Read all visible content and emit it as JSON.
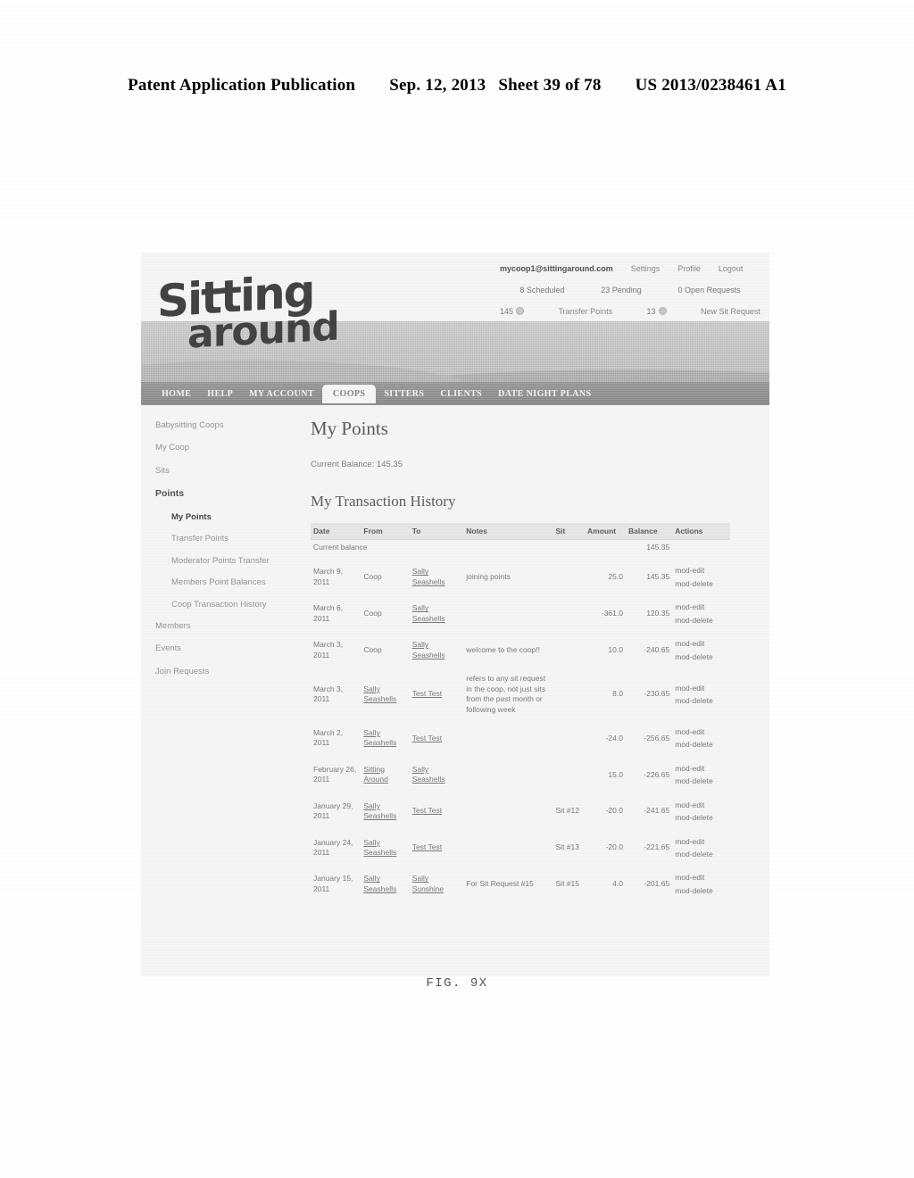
{
  "patent_header": {
    "publication": "Patent Application Publication",
    "date": "Sep. 12, 2013",
    "sheet": "Sheet 39 of 78",
    "number": "US 2013/0238461 A1"
  },
  "figure_caption": "FIG. 9X",
  "site": {
    "logo_line1": "Sitting",
    "logo_line2": "around",
    "account": {
      "email": "mycoop1@sittingaround.com",
      "settings_label": "Settings",
      "profile_label": "Profile",
      "logout_label": "Logout",
      "scheduled": "8 Scheduled",
      "pending": "23 Pending",
      "open_requests": "0 Open Requests",
      "points_balance": "145",
      "transfer_points_label": "Transfer Points",
      "sit_count": "13",
      "new_sit_request_label": "New Sit Request"
    },
    "nav": [
      {
        "label": "HOME",
        "active": false
      },
      {
        "label": "HELP",
        "active": false
      },
      {
        "label": "MY ACCOUNT",
        "active": false
      },
      {
        "label": "COOPS",
        "active": true
      },
      {
        "label": "SITTERS",
        "active": false
      },
      {
        "label": "CLIENTS",
        "active": false
      },
      {
        "label": "DATE NIGHT PLANS",
        "active": false
      }
    ],
    "sidebar": {
      "items": [
        {
          "label": "Babysitting Coops",
          "level": "top"
        },
        {
          "label": "My Coop",
          "level": "top"
        },
        {
          "label": "Sits",
          "level": "top"
        },
        {
          "label": "Points",
          "level": "head"
        },
        {
          "label": "My Points",
          "level": "sub-current"
        },
        {
          "label": "Transfer Points",
          "level": "sub"
        },
        {
          "label": "Moderator Points Transfer",
          "level": "sub"
        },
        {
          "label": "Members Point Balances",
          "level": "sub"
        },
        {
          "label": "Coop Transaction History",
          "level": "sub"
        },
        {
          "label": "Members",
          "level": "top"
        },
        {
          "label": "Events",
          "level": "top"
        },
        {
          "label": "Join Requests",
          "level": "top"
        }
      ]
    },
    "main": {
      "page_title": "My Points",
      "current_balance_line": "Current Balance: 145.35",
      "section_title": "My Transaction History",
      "table": {
        "columns": [
          "Date",
          "From",
          "To",
          "Notes",
          "Sit",
          "Amount",
          "Balance",
          "Actions"
        ],
        "current_balance_row": {
          "label": "Current balance",
          "balance": "145.35"
        },
        "action_edit": "mod-edit",
        "action_delete": "mod-delete",
        "rows": [
          {
            "date": "March 9, 2011",
            "from": "Coop",
            "to": "Sally Seashells",
            "notes": "joining points",
            "sit": "",
            "amount": "25.0",
            "balance": "145.35"
          },
          {
            "date": "March 6, 2011",
            "from": "Coop",
            "to": "Sally Seashells",
            "notes": "",
            "sit": "",
            "amount": "-361.0",
            "balance": "120.35"
          },
          {
            "date": "March 3, 2011",
            "from": "Coop",
            "to": "Sally Seashells",
            "notes": "welcome to the coop!!",
            "sit": "",
            "amount": "10.0",
            "balance": "-240.65"
          },
          {
            "date": "March 3, 2011",
            "from": "Sally Seashells",
            "to": "Test Test",
            "notes": "refers to any sit request in the coop, not just sits from the past month or following week",
            "sit": "",
            "amount": "8.0",
            "balance": "-230.65"
          },
          {
            "date": "March 2, 2011",
            "from": "Sally Seashells",
            "to": "Test Test",
            "notes": "",
            "sit": "",
            "amount": "-24.0",
            "balance": "-256.65"
          },
          {
            "date": "February 26, 2011",
            "from": "Sitting Around",
            "to": "Sally Seashells",
            "notes": "",
            "sit": "",
            "amount": "15.0",
            "balance": "-226.65"
          },
          {
            "date": "January 29, 2011",
            "from": "Sally Seashells",
            "to": "Test Test",
            "notes": "",
            "sit": "Sit #12",
            "amount": "-20.0",
            "balance": "-241.65"
          },
          {
            "date": "January 24, 2011",
            "from": "Sally Seashells",
            "to": "Test Test",
            "notes": "",
            "sit": "Sit #13",
            "amount": "-20.0",
            "balance": "-221.65"
          },
          {
            "date": "January 15, 2011",
            "from": "Sally Seashells",
            "to": "Sally Sunshine",
            "notes": "For Sit Request #15",
            "sit": "Sit #15",
            "amount": "4.0",
            "balance": "-201.65"
          }
        ]
      }
    }
  }
}
